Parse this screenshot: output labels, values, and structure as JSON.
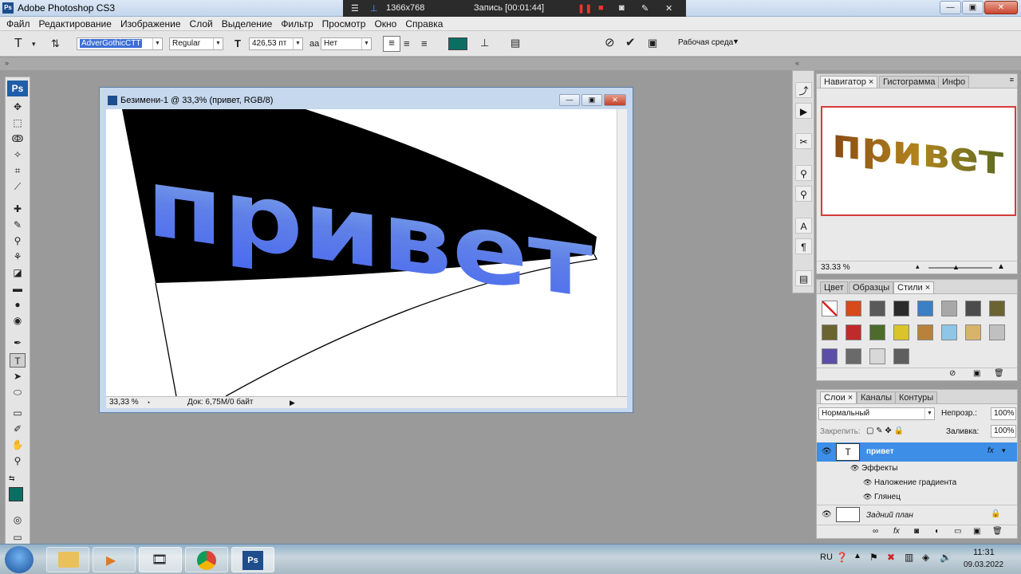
{
  "app": {
    "title": "Adobe Photoshop CS3",
    "logo": "Ps",
    "window_buttons": [
      "—",
      "▣",
      "✕"
    ]
  },
  "recorder": {
    "resolution": "1366x768",
    "status": "Запись [00:01:44]"
  },
  "menu": [
    "Файл",
    "Редактирование",
    "Изображение",
    "Слой",
    "Выделение",
    "Фильтр",
    "Просмотр",
    "Окно",
    "Справка"
  ],
  "options": {
    "font_family": "AdverGothicCTT",
    "font_style": "Regular",
    "font_size": "426,53 пт",
    "antialias": "Нет",
    "text_color": "#0c6e63",
    "workspace": "Рабочая среда"
  },
  "document": {
    "title": "Безимени-1 @ 33,3% (привет, RGB/8)",
    "canvas_text": "привет",
    "zoom": "33,33 %",
    "doc_info": "Док: 6,75M/0 байт"
  },
  "navigator": {
    "tabs": [
      "Навигатор",
      "Гистограмма",
      "Инфо"
    ],
    "preview_text": "привет",
    "zoom": "33.33 %"
  },
  "styles": {
    "tabs": [
      "Цвет",
      "Образцы",
      "Стили"
    ],
    "swatches": [
      "#ffffff",
      "#d94a1a",
      "#5a5a5a",
      "#2a2a2a",
      "#3b7fc4",
      "#a8a8a8",
      "#4c4c4c",
      "#6b6330",
      "#6b6330",
      "#c02a2a",
      "#4d6b2a",
      "#d9c42a",
      "#b8823c",
      "#8ec6e8",
      "#d8b46a",
      "#c0c0c0",
      "#5a4ea8",
      "#6a6a6a",
      "#d8d8d8",
      "#5e5e5e"
    ]
  },
  "layers": {
    "tabs": [
      "Слои",
      "Каналы",
      "Контуры"
    ],
    "blend_mode": "Нормальный",
    "opacity_label": "Непрозр.:",
    "opacity": "100%",
    "lock_label": "Закрепить:",
    "fill_label": "Заливка:",
    "fill": "100%",
    "text_layer": "привет",
    "effects_label": "Эффекты",
    "effect1": "Наложение градиента",
    "effect2": "Глянец",
    "background_layer": "Задний план",
    "fx": "fx"
  },
  "taskbar": {
    "lang": "RU",
    "time": "11:31",
    "date": "09.03.2022",
    "ps_label": "Ps"
  },
  "colors": {
    "foreground": "#0c6e63",
    "selection": "#3d8ee6"
  }
}
